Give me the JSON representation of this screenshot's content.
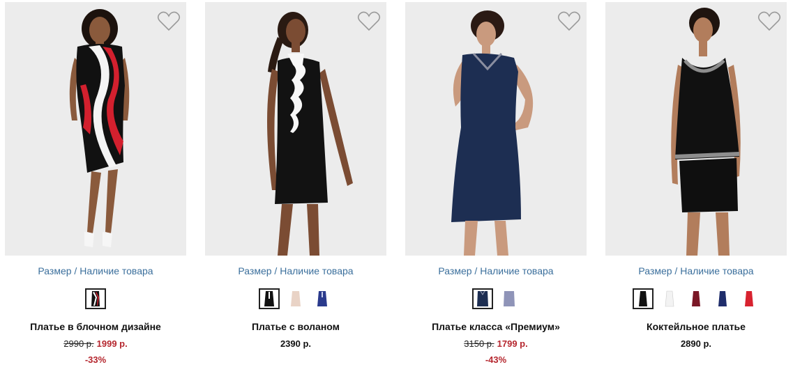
{
  "products": [
    {
      "size_link": "Размер / Наличие товара",
      "name": "Платье в блочном дизайне",
      "old_price": "2990 р.",
      "price": "1999 р.",
      "discount": "-33%",
      "swatches": [
        {
          "color": "black-red-white",
          "selected": true
        }
      ],
      "heart_icon": "heart-outline-icon"
    },
    {
      "size_link": "Размер / Наличие товара",
      "name": "Платье с воланом",
      "price": "2390 р.",
      "swatches": [
        {
          "color": "black",
          "selected": true
        },
        {
          "color": "beige",
          "selected": false
        },
        {
          "color": "navy",
          "selected": false
        }
      ],
      "heart_icon": "heart-outline-icon"
    },
    {
      "size_link": "Размер / Наличие товара",
      "name": "Платье класса «Премиум»",
      "old_price": "3150 р.",
      "price": "1799 р.",
      "discount": "-43%",
      "swatches": [
        {
          "color": "dark-navy",
          "selected": true
        },
        {
          "color": "lavender-grey",
          "selected": false
        }
      ],
      "heart_icon": "heart-outline-icon"
    },
    {
      "size_link": "Размер / Наличие товара",
      "name": "Коктейльное платье",
      "price": "2890 р.",
      "swatches": [
        {
          "color": "black",
          "selected": true
        },
        {
          "color": "white",
          "selected": false
        },
        {
          "color": "burgundy",
          "selected": false
        },
        {
          "color": "navy",
          "selected": false
        },
        {
          "color": "red",
          "selected": false
        }
      ],
      "heart_icon": "heart-outline-icon"
    }
  ],
  "colors": {
    "link": "#3b6f9c",
    "sale": "#b5262e",
    "photo_bg": "#ededed"
  }
}
